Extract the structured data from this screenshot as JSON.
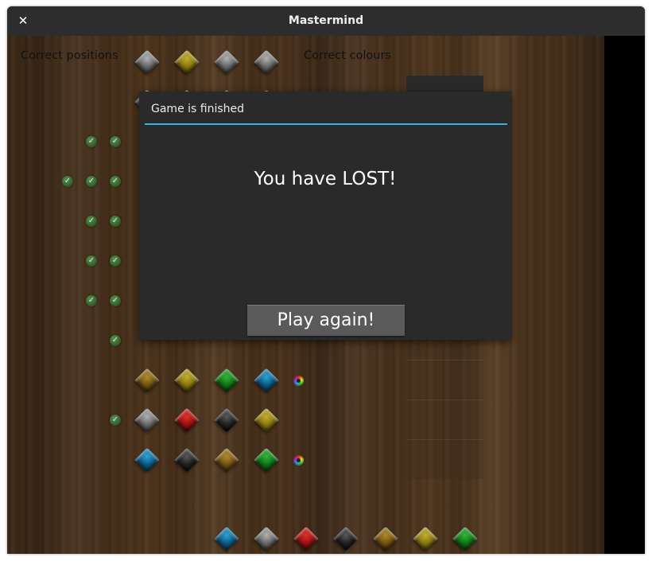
{
  "window": {
    "title": "Mastermind",
    "close_glyph": "✕"
  },
  "board": {
    "left_header": "Correct positions",
    "right_header": "Correct colours",
    "colors": {
      "grey": "#8a8a8a",
      "yellow": "#9a8a1a",
      "red": "#b01818",
      "black": "#1a1a1a",
      "green": "#1a8a22",
      "blue": "#1a78a8",
      "bronze": "#8a6418"
    },
    "header_row": [
      "grey",
      "yellow",
      "grey",
      "grey"
    ],
    "peg_rows": [
      {
        "pegs": [
          "grey",
          "yellow",
          "grey",
          "red"
        ],
        "correct_positions": 0,
        "correct_colours": 0
      },
      {
        "pegs": [],
        "correct_positions": 2,
        "correct_colours": 0
      },
      {
        "pegs": [],
        "correct_positions": 3,
        "correct_colours": 0
      },
      {
        "pegs": [],
        "correct_positions": 2,
        "correct_colours": 0
      },
      {
        "pegs": [],
        "correct_positions": 2,
        "correct_colours": 0
      },
      {
        "pegs": [],
        "correct_positions": 2,
        "correct_colours": 0
      },
      {
        "pegs": [],
        "correct_positions": 1,
        "correct_colours": 0
      },
      {
        "pegs": [
          "bronze",
          "yellow",
          "green",
          "blue"
        ],
        "correct_positions": 0,
        "correct_colours": 1
      },
      {
        "pegs": [
          "grey",
          "red",
          "black",
          "yellow"
        ],
        "correct_positions": 1,
        "correct_colours": 0
      },
      {
        "pegs": [
          "blue",
          "black",
          "bronze",
          "green"
        ],
        "correct_positions": 0,
        "correct_colours": 1
      }
    ],
    "palette": [
      "blue",
      "grey",
      "red",
      "black",
      "bronze",
      "yellow",
      "green"
    ]
  },
  "dialog": {
    "title": "Game is finished",
    "message": "You have LOST!",
    "button_label": "Play again!"
  }
}
